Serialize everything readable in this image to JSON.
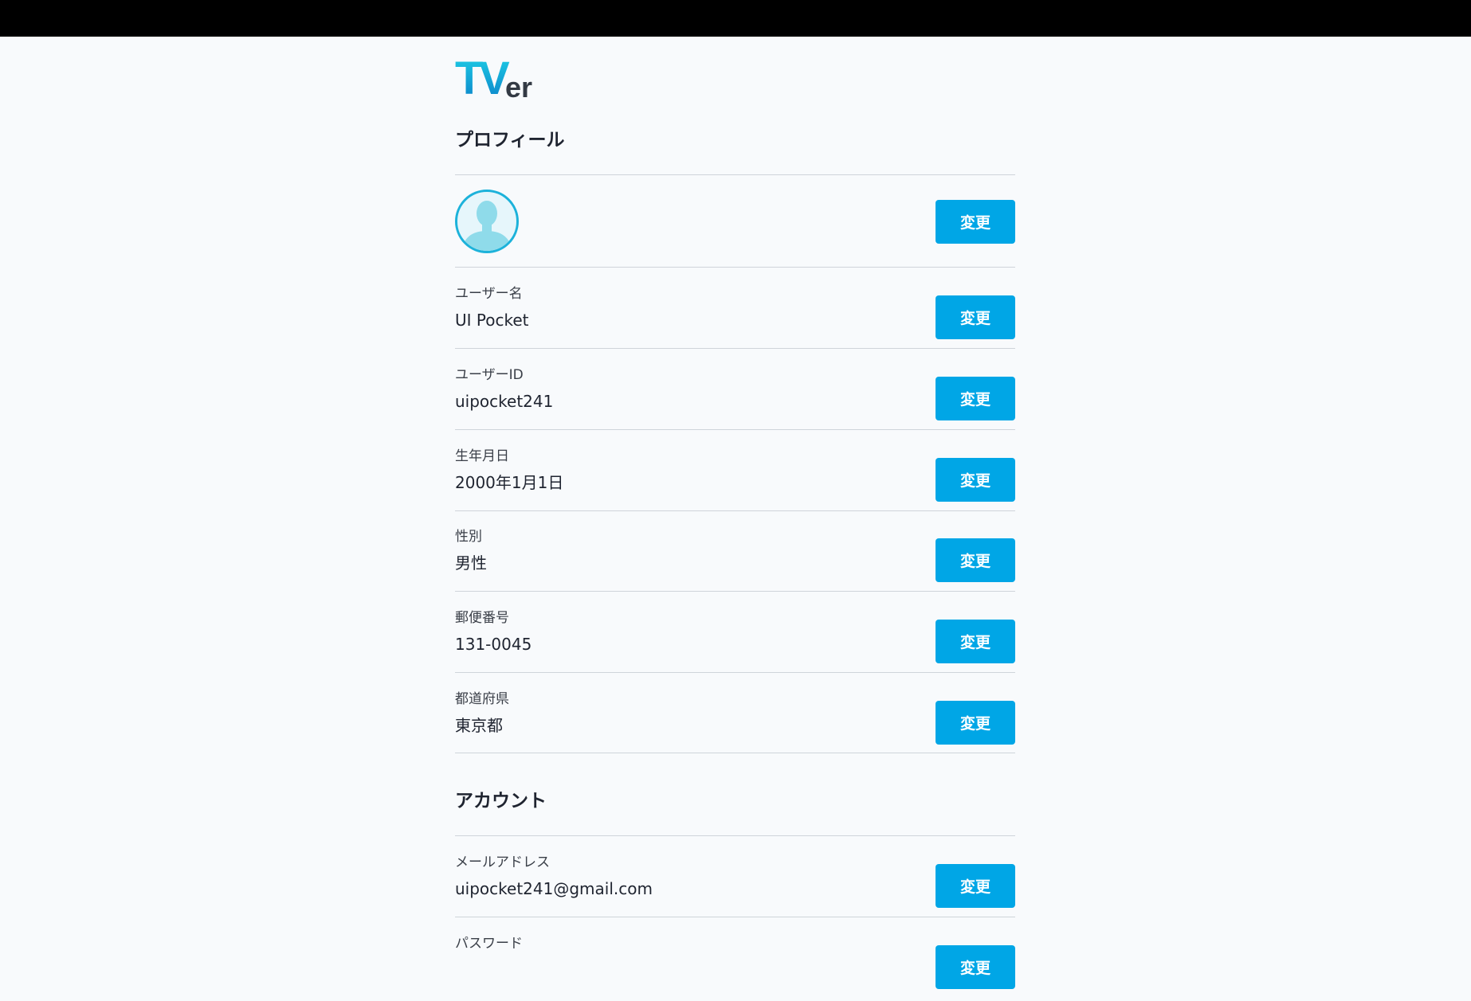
{
  "logo": {
    "text_t": "T",
    "text_v": "V",
    "text_er": "er"
  },
  "profile": {
    "section_title": "プロフィール",
    "change_label": "変更",
    "rows": [
      {
        "label": "ユーザー名",
        "value": "UI Pocket"
      },
      {
        "label": "ユーザーID",
        "value": "uipocket241"
      },
      {
        "label": "生年月日",
        "value": "2000年1月1日"
      },
      {
        "label": "性別",
        "value": "男性"
      },
      {
        "label": "郵便番号",
        "value": "131-0045"
      },
      {
        "label": "都道府県",
        "value": "東京都"
      }
    ]
  },
  "account": {
    "section_title": "アカウント",
    "change_label": "変更",
    "rows": [
      {
        "label": "メールアドレス",
        "value": "uipocket241@gmail.com"
      },
      {
        "label": "パスワード",
        "value": ""
      }
    ]
  },
  "colors": {
    "accent": "#00a6e6",
    "topbar": "#000000",
    "background": "#f8fafc",
    "divider": "#cfd4da"
  },
  "icons": {
    "avatar": "user-avatar-icon"
  }
}
